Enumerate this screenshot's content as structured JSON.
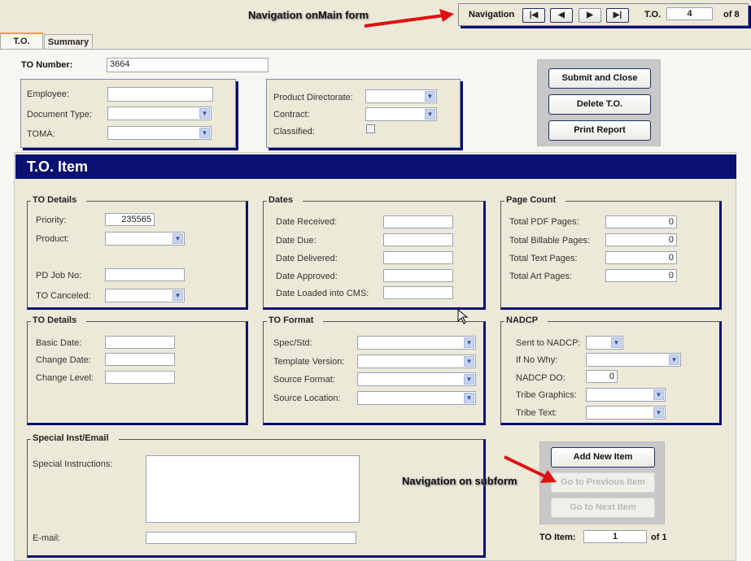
{
  "annotations": {
    "main_nav": "Navigation onMain form",
    "sub_nav": "Navigation on subform"
  },
  "nav": {
    "label": "Navigation",
    "first": "first-record",
    "prev": "previous-record",
    "next": "next-record",
    "last": "last-record",
    "record_label": "T.O.",
    "record": "4",
    "of": "of 8"
  },
  "tabs": [
    {
      "label": "T.O."
    },
    {
      "label": "Summary"
    }
  ],
  "header": {
    "to_number_label": "TO Number:",
    "to_number": "3664",
    "employee_label": "Employee:",
    "employee": "",
    "doc_type_label": "Document Type:",
    "toma_label": "TOMA:",
    "product_dir_label": "Product Directorate:",
    "contract_label": "Contract:",
    "classified_label": "Classified:"
  },
  "actions": {
    "submit": "Submit and Close",
    "delete": "Delete T.O.",
    "print": "Print Report"
  },
  "item": {
    "title": "T.O. Item",
    "details1": {
      "legend": "TO Details",
      "priority_label": "Priority:",
      "priority": "235565",
      "product_label": "Product:",
      "pd_job_label": "PD Job No:",
      "canceled_label": "TO Canceled:"
    },
    "dates": {
      "legend": "Dates",
      "fields": [
        "Date Received:",
        "Date Due:",
        "Date Delivered:",
        "Date Approved:",
        "Date Loaded into CMS:"
      ]
    },
    "pages": {
      "legend": "Page Count",
      "fields": [
        {
          "label": "Total PDF Pages:",
          "value": "0"
        },
        {
          "label": "Total Billable Pages:",
          "value": "0"
        },
        {
          "label": "Total Text Pages:",
          "value": "0"
        },
        {
          "label": "Total Art Pages:",
          "value": "0"
        }
      ]
    },
    "details2": {
      "legend": "TO Details",
      "fields": [
        "Basic Date:",
        "Change Date:",
        "Change Level:"
      ]
    },
    "format": {
      "legend": "TO Format",
      "fields": [
        "Spec/Std:",
        "Template Version:",
        "Source Format:",
        "Source Location:"
      ]
    },
    "nadcp": {
      "legend": "NADCP",
      "sent_label": "Sent to NADCP:",
      "why_label": "If No Why:",
      "do_label": "NADCP DO:",
      "do_value": "0",
      "graphics_label": "Tribe Graphics:",
      "text_label": "Tribe Text:"
    },
    "special": {
      "legend": "Special Inst/Email",
      "instructions_label": "Special Instructions:",
      "email_label": "E-mail:"
    },
    "buttons": {
      "add": "Add New Item",
      "prev": "Go to Previous Item",
      "next": "Go to Next Item"
    },
    "counter": {
      "label": "TO Item:",
      "value": "1",
      "of": "of 1"
    }
  },
  "colors": {
    "navy": "#0a1170",
    "panel": "#ece9d8",
    "arrow": "#e01010"
  }
}
